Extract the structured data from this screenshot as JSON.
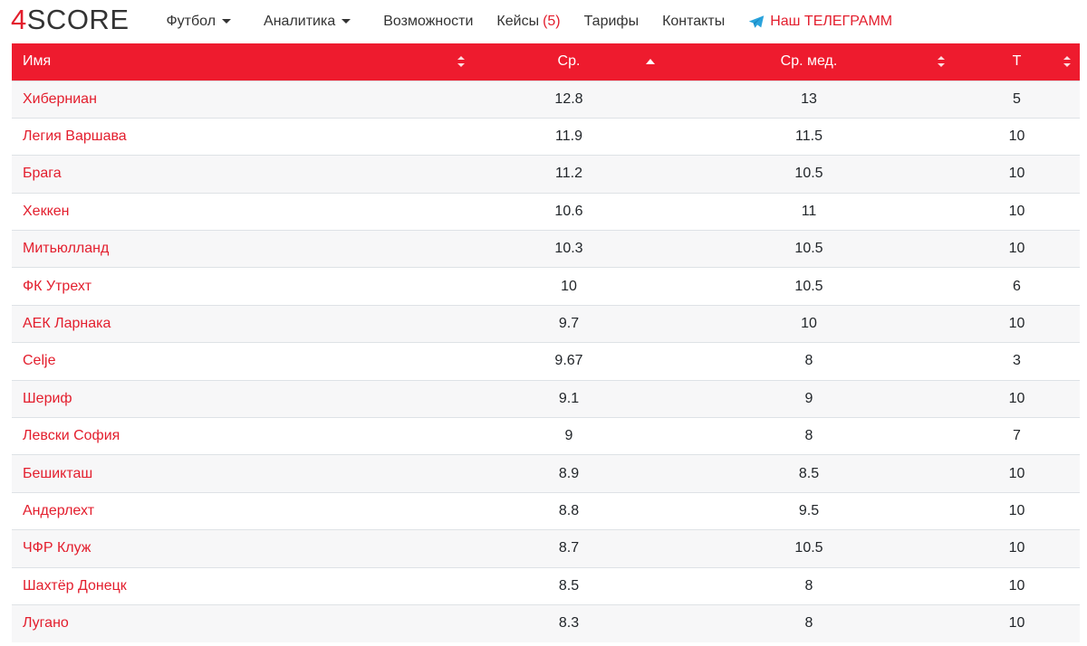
{
  "nav": {
    "logo_num": "4",
    "logo_text": "SCORE",
    "football": "Футбол",
    "analytics": "Аналитика",
    "features": "Возможности",
    "cases": "Кейсы",
    "cases_count": "(5)",
    "pricing": "Тарифы",
    "contacts": "Контакты",
    "telegram": "Наш ТЕЛЕГРАММ"
  },
  "colors": {
    "accent": "#ee1b2e",
    "link": "#e31e2d"
  },
  "table": {
    "columns": [
      "Имя",
      "Ср.",
      "Ср. мед.",
      "Т"
    ],
    "rows": [
      [
        "Хиберниан",
        "12.8",
        "13",
        "5"
      ],
      [
        "Легия Варшава",
        "11.9",
        "11.5",
        "10"
      ],
      [
        "Брага",
        "11.2",
        "10.5",
        "10"
      ],
      [
        "Хеккен",
        "10.6",
        "11",
        "10"
      ],
      [
        "Митьюлланд",
        "10.3",
        "10.5",
        "10"
      ],
      [
        "ФК Утрехт",
        "10",
        "10.5",
        "6"
      ],
      [
        "АЕК Ларнака",
        "9.7",
        "10",
        "10"
      ],
      [
        "Celje",
        "9.67",
        "8",
        "3"
      ],
      [
        "Шериф",
        "9.1",
        "9",
        "10"
      ],
      [
        "Левски София",
        "9",
        "8",
        "7"
      ],
      [
        "Бешикташ",
        "8.9",
        "8.5",
        "10"
      ],
      [
        "Андерлехт",
        "8.8",
        "9.5",
        "10"
      ],
      [
        "ЧФР Клуж",
        "8.7",
        "10.5",
        "10"
      ],
      [
        "Шахтёр Донецк",
        "8.5",
        "8",
        "10"
      ],
      [
        "Лугано",
        "8.3",
        "8",
        "10"
      ]
    ]
  }
}
